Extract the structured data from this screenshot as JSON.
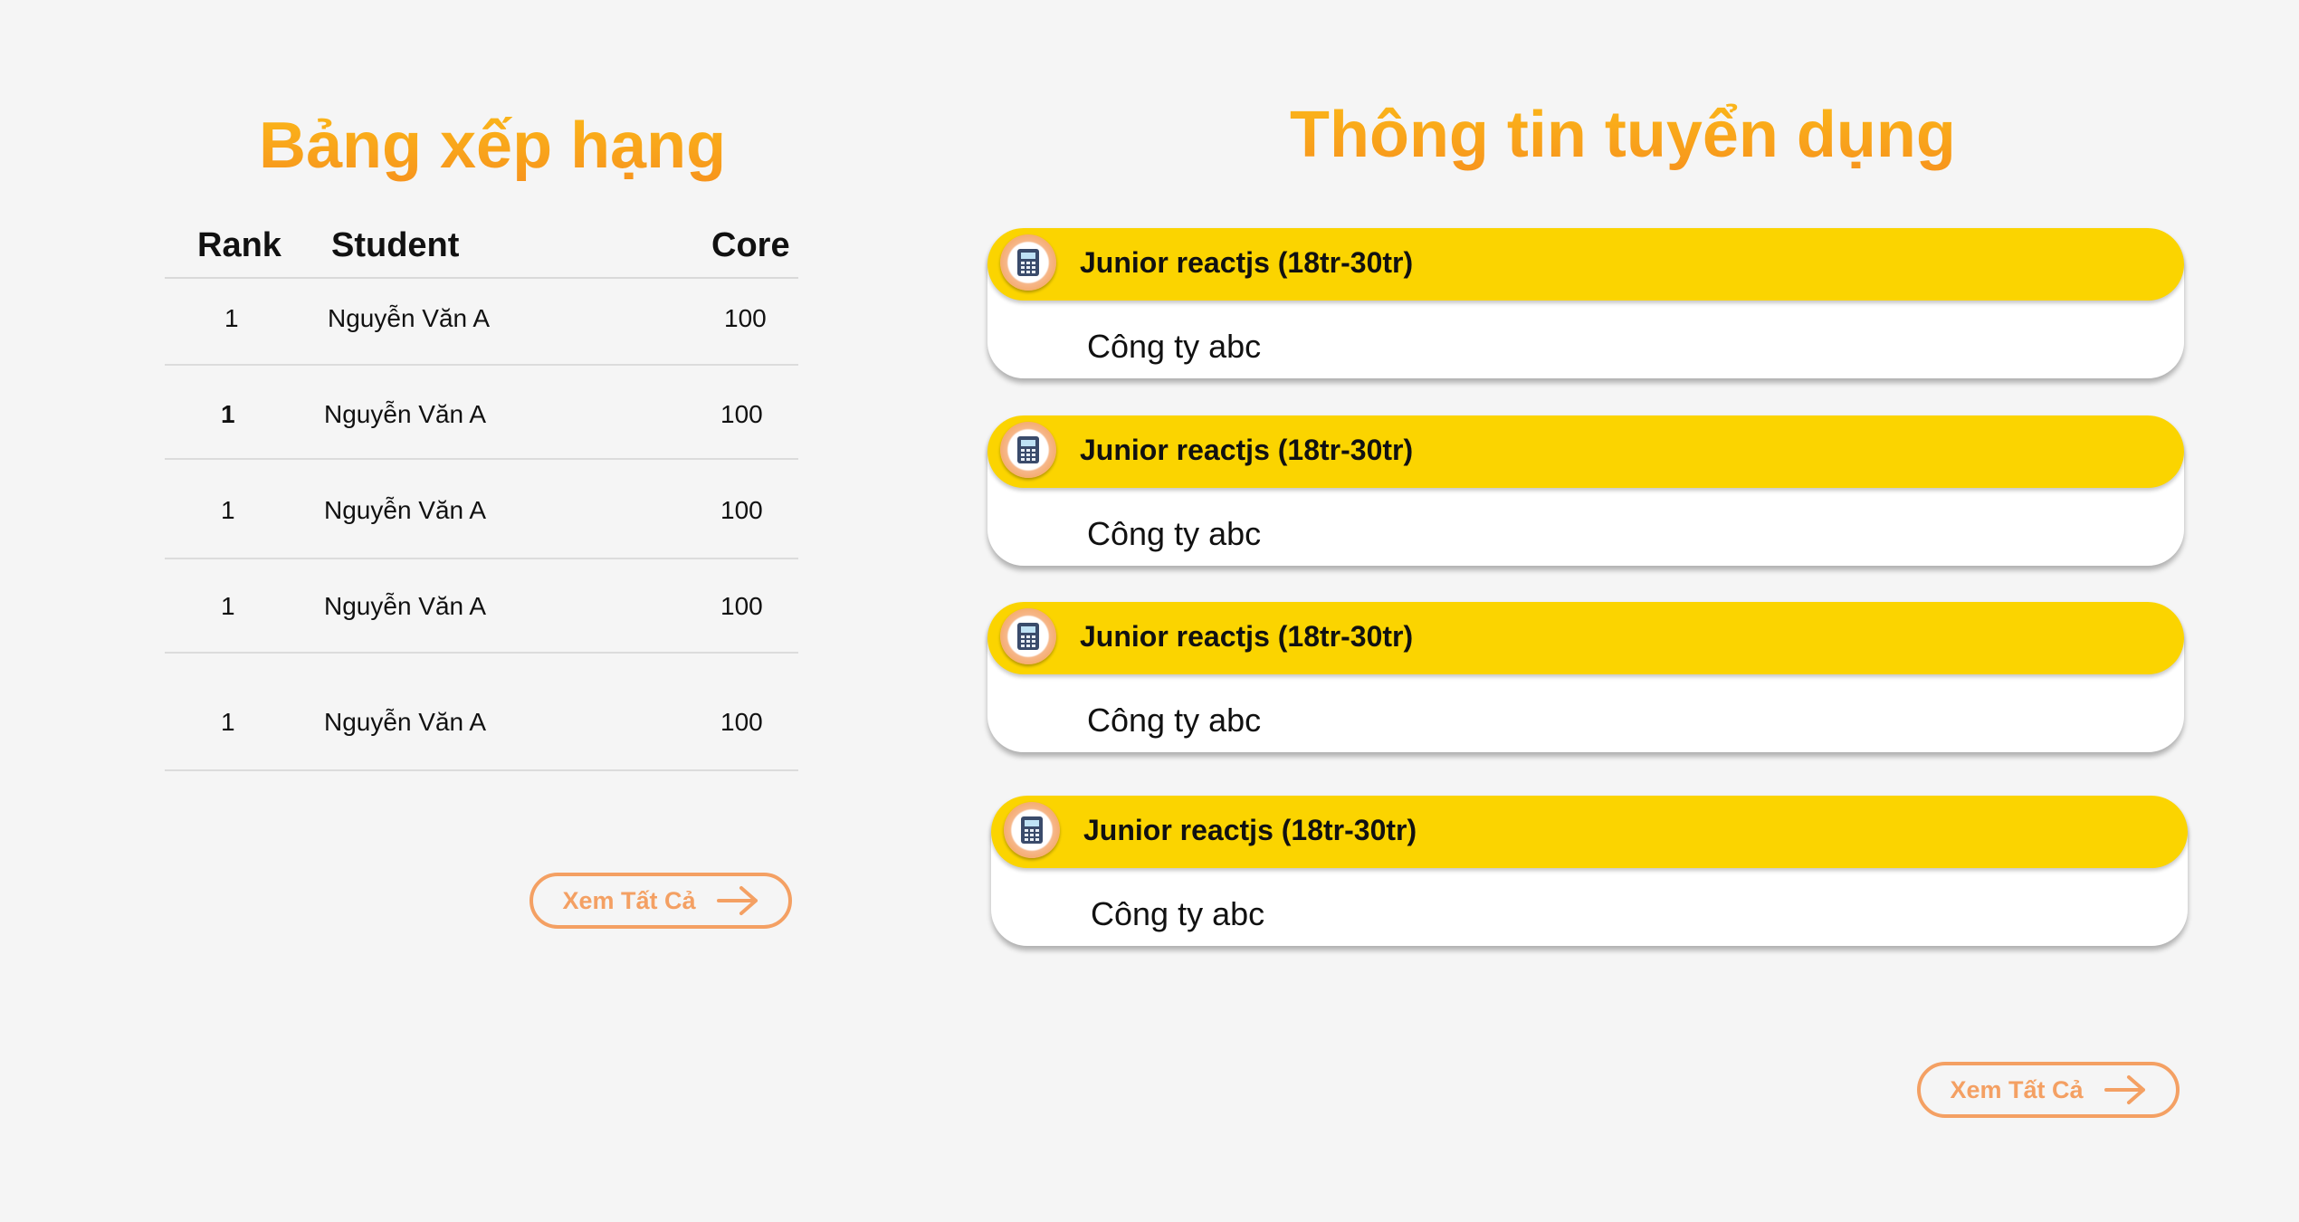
{
  "ranking": {
    "title": "Bảng xếp hạng",
    "columns": {
      "rank": "Rank",
      "student": "Student",
      "score": "Core"
    },
    "rows": [
      {
        "rank": "1",
        "student": "Nguyễn Văn A",
        "score": "100"
      },
      {
        "rank": "1",
        "student": "Nguyễn Văn A",
        "score": "100"
      },
      {
        "rank": "1",
        "student": "Nguyễn Văn A",
        "score": "100"
      },
      {
        "rank": "1",
        "student": "Nguyễn Văn A",
        "score": "100"
      },
      {
        "rank": "1",
        "student": "Nguyễn Văn A",
        "score": "100"
      }
    ],
    "view_all": "Xem Tất Cả"
  },
  "jobs": {
    "title": "Thông tin tuyển dụng",
    "items": [
      {
        "title": "Junior reactjs (18tr-30tr)",
        "company": "Công ty abc"
      },
      {
        "title": "Junior reactjs (18tr-30tr)",
        "company": "Công ty abc"
      },
      {
        "title": "Junior reactjs (18tr-30tr)",
        "company": "Công ty abc"
      },
      {
        "title": "Junior reactjs (18tr-30tr)",
        "company": "Công ty abc"
      }
    ],
    "view_all": "Xem Tất Cả"
  },
  "colors": {
    "heading_orange": "#f7941d",
    "card_header_yellow": "#fbd400",
    "button_outline": "#f4a063",
    "background": "#f5f5f5"
  },
  "icons": {
    "job": "calculator-icon",
    "button": "arrow-right-icon"
  }
}
